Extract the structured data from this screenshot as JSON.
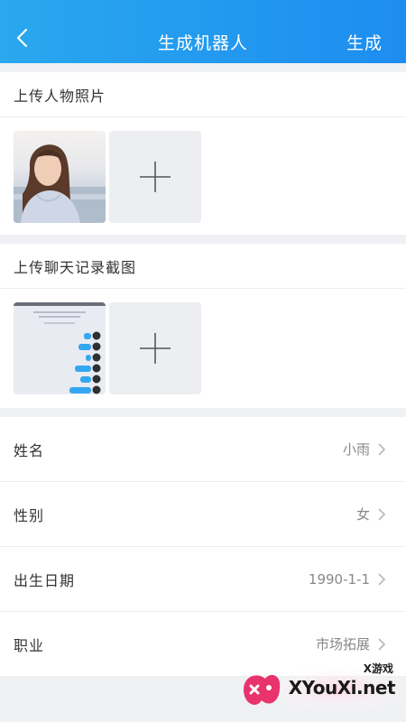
{
  "navbar": {
    "title": "生成机器人",
    "action_label": "生成"
  },
  "photo_section": {
    "title": "上传人物照片"
  },
  "chat_section": {
    "title": "上传聊天记录截图"
  },
  "form": {
    "rows": [
      {
        "label": "姓名",
        "value": "小雨"
      },
      {
        "label": "性别",
        "value": "女"
      },
      {
        "label": "出生日期",
        "value": "1990-1-1"
      },
      {
        "label": "职业",
        "value": "市场拓展"
      }
    ]
  },
  "watermark": {
    "small": "X游戏",
    "large": "XYouXi.net"
  },
  "colors": {
    "nav_start": "#29a8ee",
    "nav_end": "#1d8df0",
    "accent_pink": "#e8336d"
  }
}
